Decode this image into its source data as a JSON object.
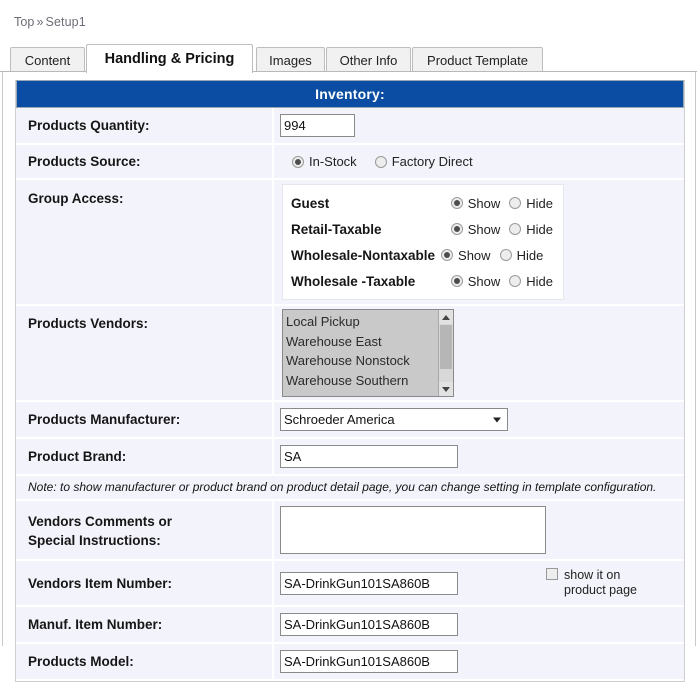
{
  "breadcrumb": {
    "root": "Top",
    "separator": "»",
    "current": "Setup1"
  },
  "tabs": [
    {
      "label": "Content",
      "active": false
    },
    {
      "label": "Handling & Pricing",
      "active": true
    },
    {
      "label": "Images",
      "active": false
    },
    {
      "label": "Other Info",
      "active": false
    },
    {
      "label": "Product Template",
      "active": false
    }
  ],
  "section": {
    "title": "Inventory:",
    "header_color": "#0b4da2"
  },
  "fields": {
    "products_quantity": {
      "label": "Products Quantity:",
      "value": "994"
    },
    "products_source": {
      "label": "Products Source:",
      "options": [
        {
          "label": "In-Stock",
          "selected": true
        },
        {
          "label": "Factory Direct",
          "selected": false
        }
      ]
    },
    "group_access": {
      "label": "Group Access:",
      "groups": [
        {
          "name": "Guest",
          "show_label": "Show",
          "hide_label": "Hide",
          "value": "Show"
        },
        {
          "name": "Retail-Taxable",
          "show_label": "Show",
          "hide_label": "Hide",
          "value": "Show"
        },
        {
          "name": "Wholesale-Nontaxable",
          "show_label": "Show",
          "hide_label": "Hide",
          "value": "Show"
        },
        {
          "name": "Wholesale -Taxable",
          "show_label": "Show",
          "hide_label": "Hide",
          "value": "Show"
        }
      ]
    },
    "products_vendors": {
      "label": "Products Vendors:",
      "items": [
        "Local Pickup",
        "Warehouse East",
        "Warehouse Nonstock",
        "Warehouse Southern"
      ]
    },
    "products_manufacturer": {
      "label": "Products Manufacturer:",
      "value": "Schroeder America"
    },
    "product_brand": {
      "label": "Product Brand:",
      "value": "SA"
    },
    "note": "Note: to show manufacturer or product brand on product detail page, you can change setting in template configuration.",
    "vendors_comments": {
      "label_line1": "Vendors Comments or",
      "label_line2": "Special Instructions:",
      "value": ""
    },
    "vendors_item_number": {
      "label": "Vendors Item Number:",
      "value": "SA-DrinkGun101SA860B",
      "checkbox_line1": "show it on",
      "checkbox_line2": "product page",
      "checked": false
    },
    "manuf_item_number": {
      "label": "Manuf. Item Number:",
      "value": "SA-DrinkGun101SA860B"
    },
    "products_model": {
      "label": "Products Model:",
      "value": "SA-DrinkGun101SA860B"
    }
  }
}
